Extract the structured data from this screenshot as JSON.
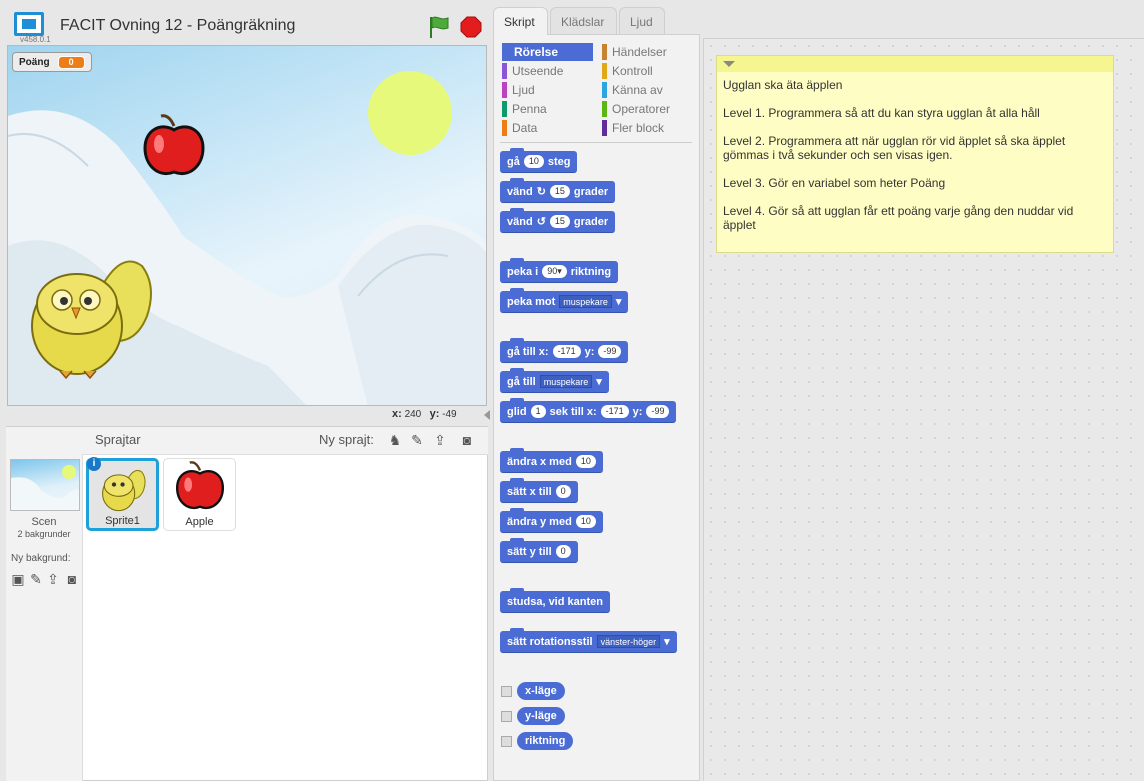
{
  "header": {
    "title": "FACIT Ovning 12 - Poängräkning",
    "version": "v458.0.1"
  },
  "stage": {
    "variable_name": "Poäng",
    "variable_value": "0",
    "x_label": "x:",
    "x_value": "240",
    "y_label": "y:",
    "y_value": "-49"
  },
  "sprites": {
    "header_label": "Sprajtar",
    "new_sprite_label": "Ny sprajt:",
    "scene_name": "Scen",
    "scene_sub": "2 bakgrunder",
    "new_background_label": "Ny bakgrund:",
    "items": [
      {
        "name": "Sprite1"
      },
      {
        "name": "Apple"
      }
    ]
  },
  "tabs": [
    "Skript",
    "Klädslar",
    "Ljud"
  ],
  "categories": {
    "left": [
      {
        "label": "Rörelse",
        "color": "#4a6cd4"
      },
      {
        "label": "Utseende",
        "color": "#8a55d7"
      },
      {
        "label": "Ljud",
        "color": "#bb42c3"
      },
      {
        "label": "Penna",
        "color": "#0e9a6c"
      },
      {
        "label": "Data",
        "color": "#ee7d16"
      }
    ],
    "right": [
      {
        "label": "Händelser",
        "color": "#c88330"
      },
      {
        "label": "Kontroll",
        "color": "#e1a91a"
      },
      {
        "label": "Känna av",
        "color": "#2ca5e2"
      },
      {
        "label": "Operatorer",
        "color": "#5cb712"
      },
      {
        "label": "Fler block",
        "color": "#632d99"
      }
    ]
  },
  "blocks": {
    "move": {
      "a": "gå",
      "b": "10",
      "c": "steg"
    },
    "turn_right": {
      "a": "vänd",
      "b": "15",
      "c": "grader"
    },
    "turn_left": {
      "a": "vänd",
      "b": "15",
      "c": "grader"
    },
    "point_dir": {
      "a": "peka i",
      "b": "90▾",
      "c": "riktning"
    },
    "point_towards": {
      "a": "peka mot",
      "b": "muspekare"
    },
    "goto_xy": {
      "a": "gå till x:",
      "b": "-171",
      "c": "y:",
      "d": "-99"
    },
    "goto": {
      "a": "gå till",
      "b": "muspekare"
    },
    "glide": {
      "a": "glid",
      "b": "1",
      "c": "sek till x:",
      "d": "-171",
      "e": "y:",
      "f": "-99"
    },
    "change_x": {
      "a": "ändra x med",
      "b": "10"
    },
    "set_x": {
      "a": "sätt x till",
      "b": "0"
    },
    "change_y": {
      "a": "ändra y med",
      "b": "10"
    },
    "set_y": {
      "a": "sätt y till",
      "b": "0"
    },
    "bounce": {
      "a": "studsa, vid kanten"
    },
    "rotation_style": {
      "a": "sätt rotationsstil",
      "b": "vänster-höger"
    },
    "reporters": [
      "x-läge",
      "y-läge",
      "riktning"
    ]
  },
  "note": {
    "lines": [
      "Ugglan ska äta äpplen",
      "Level 1. Programmera så att du kan styra ugglan åt alla håll",
      "Level 2. Programmera att när ugglan rör vid äpplet så ska äpplet gömmas i två sekunder och sen visas igen.",
      "Level 3. Gör en variabel som heter Poäng",
      "Level 4. Gör så att ugglan får ett poäng varje gång den nuddar vid äpplet"
    ]
  }
}
